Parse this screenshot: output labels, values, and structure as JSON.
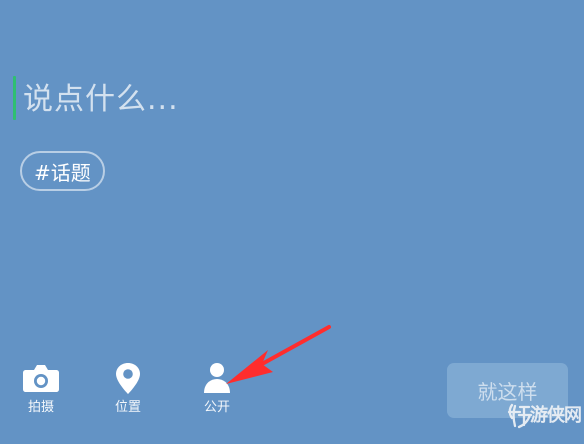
{
  "composer": {
    "placeholder": "说点什么...",
    "topic_tag": "#话题"
  },
  "toolbar": {
    "camera": {
      "label": "拍摄",
      "icon": "camera-icon"
    },
    "location": {
      "label": "位置",
      "icon": "location-pin-icon"
    },
    "privacy": {
      "label": "公开",
      "icon": "person-icon"
    }
  },
  "actions": {
    "submit_label": "就这样"
  },
  "annotation": {
    "arrow_color": "#ff2d2d",
    "points_to": "privacy"
  },
  "watermark": {
    "text": "游侠网"
  },
  "colors": {
    "background": "#6393c5",
    "caret": "#2fbf71",
    "button_disabled": "#7ea9d2"
  }
}
